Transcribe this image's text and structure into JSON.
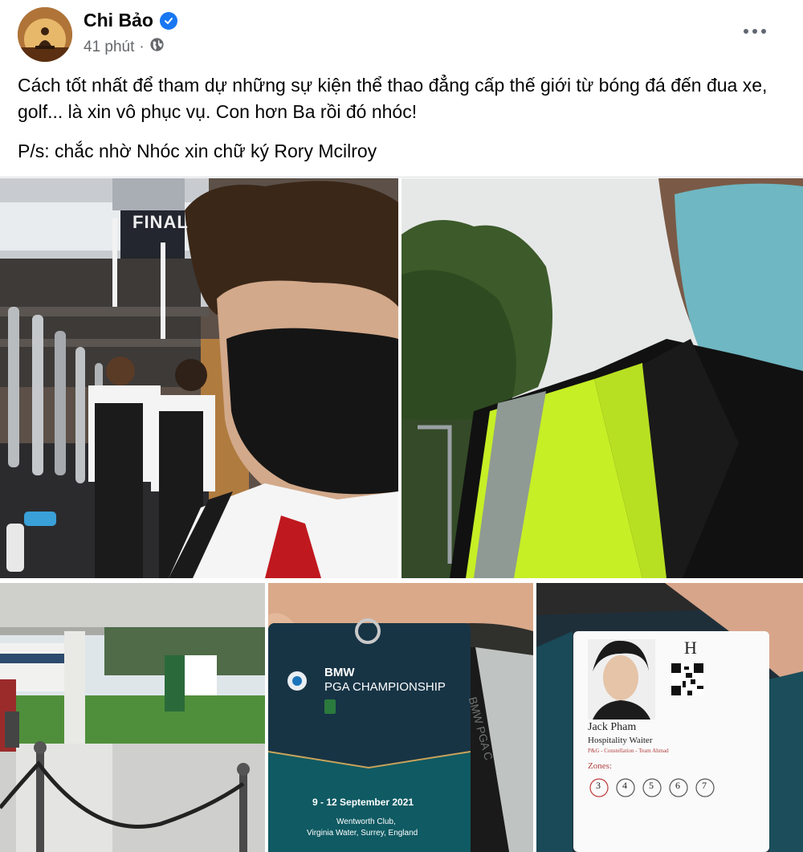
{
  "post": {
    "author": "Chi Bảo",
    "time": "41 phút",
    "body_line_1": "Cách tốt nhất để tham dự những sự kiện thể thao đẳng cấp thế giới từ bóng đá đến đua xe, golf... là xin vô phục vụ. Con hơn Ba rồi đó nhóc!",
    "body_line_2": "P/s: chắc nhờ Nhóc xin chữ ký Rory Mcilroy"
  },
  "icons": {
    "verified": "verified-badge-icon",
    "audience": "globe-icon",
    "more": "more-options-icon"
  },
  "colors": {
    "verified": "#1877f2",
    "secondary_text": "#65676b"
  },
  "photos": {
    "badge": {
      "brand": "BMW",
      "event": "PGA CHAMPIONSHIP",
      "dates": "9 - 12 September 2021",
      "venue_line_1": "Wentworth Club,",
      "venue_line_2": "Virginia Water, Surrey, England",
      "side_text": "BMW PGA C"
    },
    "id_card": {
      "letter": "H",
      "name": "Jack Pham",
      "role": "Hospitality Waiter",
      "detail": "P&G - Constellation - Team Ahmad",
      "zones_label": "Zones:",
      "zones": [
        "3",
        "4",
        "5",
        "6",
        "7"
      ]
    },
    "left_sign": "FINAL"
  }
}
